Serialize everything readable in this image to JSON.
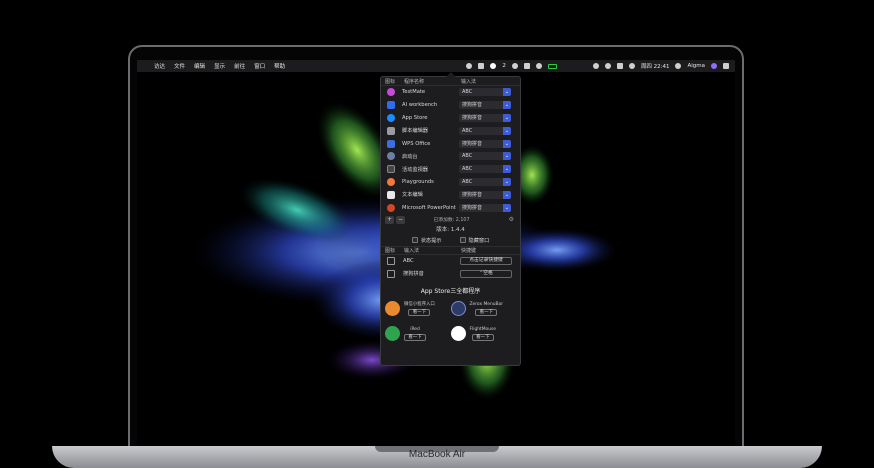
{
  "device": {
    "model_label": "MacBook Air"
  },
  "menubar": {
    "apple_glyph": "",
    "items": [
      "访达",
      "文件",
      "编辑",
      "显示",
      "前往",
      "窗口",
      "帮助"
    ],
    "status_text": "2",
    "clock": "周四 22:41",
    "user": "Aigma"
  },
  "popup": {
    "header": {
      "icon_col": "图标",
      "app_col": "程序名称",
      "im_col": "输入法"
    },
    "apps": [
      {
        "name": "TestMate",
        "im": "ABC",
        "icon": "testmate-icon",
        "color": "#c64bd6"
      },
      {
        "name": "AI workbench",
        "im": "搜狗拼音",
        "icon": "ai-workbench-icon",
        "color": "#2f6cf0"
      },
      {
        "name": "App Store",
        "im": "搜狗拼音",
        "icon": "app-store-icon",
        "color": "#1a8cff"
      },
      {
        "name": "脚本编辑器",
        "im": "ABC",
        "icon": "script-editor-icon",
        "color": "#9a9aa0"
      },
      {
        "name": "WPS Office",
        "im": "搜狗拼音",
        "icon": "wps-office-icon",
        "color": "#3b6fe0"
      },
      {
        "name": "启动台",
        "im": "ABC",
        "icon": "launchpad-icon",
        "color": "#6d7fa3"
      },
      {
        "name": "活动监视器",
        "im": "ABC",
        "icon": "activity-monitor-icon",
        "color": "#444448"
      },
      {
        "name": "Playgrounds",
        "im": "ABC",
        "icon": "playgrounds-icon",
        "color": "#f2783c"
      },
      {
        "name": "文本编辑",
        "im": "搜狗拼音",
        "icon": "textedit-icon",
        "color": "#e8e8e8"
      },
      {
        "name": "Microsoft PowerPoint",
        "im": "搜狗拼音",
        "icon": "powerpoint-icon",
        "color": "#d24726"
      }
    ],
    "toolbar": {
      "add_label": "+",
      "remove_label": "−",
      "count_text": "已添加数: 2,107",
      "gear_glyph": "⚙"
    },
    "version_text": "版本: 1.4.4",
    "options": [
      {
        "label": "状态提示",
        "checked": false
      },
      {
        "label": "隐藏窗口",
        "checked": false
      }
    ],
    "im_header": {
      "icon_col": "图标",
      "name_col": "输入法",
      "shortcut_col": "快捷键"
    },
    "input_methods": [
      {
        "name": "ABC",
        "shortcut": "点击记录快捷键"
      },
      {
        "name": "搜狗拼音",
        "shortcut": "⌃空格"
      }
    ],
    "suite_title": "App Store三全都程序",
    "suite_apps": [
      {
        "name": "微信小程序入口",
        "button": "看一下",
        "icon": "weapp-icon",
        "color": "#e88a2d"
      },
      {
        "name": "Zerox MenuBar",
        "button": "看一下",
        "icon": "zerox-menubar-icon",
        "color": "#2b3a66"
      },
      {
        "name": "iRed",
        "button": "看一下",
        "icon": "ired-icon",
        "color": "#2ea44f"
      },
      {
        "name": "FlightMouse",
        "button": "看一下",
        "icon": "flightmouse-icon",
        "color": "#ffffff"
      }
    ]
  }
}
